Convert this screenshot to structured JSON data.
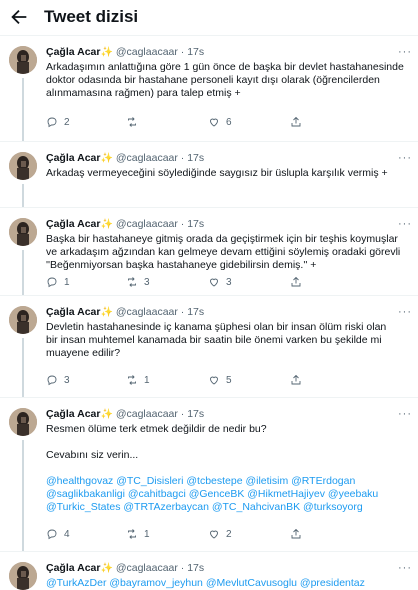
{
  "header": {
    "title": "Tweet dizisi"
  },
  "author": {
    "name": "Çağla Acar",
    "badge": "✨",
    "handle": "@caglaacaar",
    "dot": "·"
  },
  "tweets": [
    {
      "time": "17s",
      "lines": [
        "Arkadaşımın anlattığına göre 1 gün önce de başka bir devlet hastahanesinde",
        "doktor odasında bir hastahane personeli kayıt dışı olarak (öğrencilerden",
        "alınmamasına rağmen) para talep etmiş +"
      ],
      "replies": "2",
      "retweets": "",
      "likes": "6"
    },
    {
      "time": "17s",
      "lines": [
        "Arkadaş vermeyeceğini söylediğinde saygısız bir üslupla karşılık vermiş +"
      ],
      "replies": "",
      "retweets": "",
      "likes": ""
    },
    {
      "time": "17s",
      "lines": [
        "Başka bir hastahaneye gitmiş orada da geçiştirmek için bir teşhis koymuşlar",
        "ve arkadaşım ağzından kan gelmeye devam ettiğini söylemiş oradaki görevli",
        "''Beğenmiyorsan başka hastahaneye gidebilirsin demiş.'' +"
      ],
      "replies": "1",
      "retweets": "3",
      "likes": "3"
    },
    {
      "time": "17s",
      "lines": [
        "Devletin hastahanesinde iç kanama şüphesi olan bir insan ölüm riski olan",
        "bir insan muhtemel kanamada bir saatin bile önemi varken bu şekilde mi",
        "muayene edilir?"
      ],
      "replies": "3",
      "retweets": "1",
      "likes": "5"
    },
    {
      "time": "17s",
      "line1": "Resmen ölüme terk etmek değildir de nedir bu?",
      "line2": "Cevabını siz verin...",
      "mentions": [
        "@healthgovaz @TC_Disisleri @tcbestepe @iletisim @RTErdogan",
        "@saglikbakanligi @cahitbagci @GenceBK @HikmetHajiyev @yeebaku",
        "@Turkic_States @TRTAzerbaycan @TC_NahcivanBK @turksoyorg"
      ],
      "replies": "4",
      "retweets": "1",
      "likes": "2"
    },
    {
      "time": "17s",
      "mentions": [
        "@TurkAzDer @bayramov_jeyhun @MevlutCavusoglu @presidentaz"
      ]
    }
  ],
  "icons": {
    "back": "arrow-left-icon",
    "reply": "reply-icon",
    "retweet": "retweet-icon",
    "like": "heart-icon",
    "share": "share-icon",
    "more": "more-icon"
  },
  "colors": {
    "link": "#1d9bf0",
    "muted": "#536471",
    "text": "#0f1419",
    "badge": "#f4b400"
  }
}
